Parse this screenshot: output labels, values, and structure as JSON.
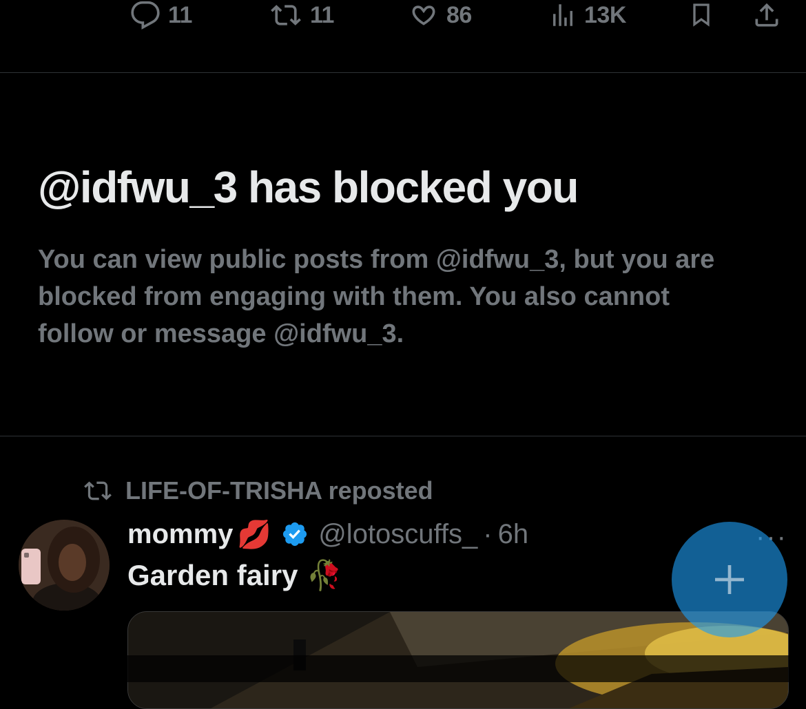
{
  "actions": {
    "reply": {
      "icon": "reply-icon",
      "count": "11"
    },
    "repost": {
      "icon": "repost-icon",
      "count": "11"
    },
    "like": {
      "icon": "heart-icon",
      "count": "86"
    },
    "views": {
      "icon": "views-icon",
      "count": "13K"
    },
    "bookmark": {
      "icon": "bookmark-icon"
    },
    "share": {
      "icon": "share-icon"
    }
  },
  "blocked": {
    "title": "@idfwu_3 has blocked you",
    "message": "You can view public posts from @idfwu_3, but you are blocked from engaging with them. You also cannot follow or message @idfwu_3."
  },
  "post": {
    "repost_text": "LIFE-OF-TRISHA reposted",
    "author_name": "mommy",
    "author_emoji": "💋",
    "verified": true,
    "handle": "@lotoscuffs_",
    "separator": "·",
    "time": "6h",
    "text": "Garden fairy",
    "text_emoji": "🥀",
    "more": "···"
  },
  "compose": {
    "icon": "plus-icon"
  },
  "colors": {
    "background": "#000000",
    "text": "#e7e9ea",
    "muted": "#71767b",
    "accent": "#1d9bf0",
    "divider": "#2f3336"
  }
}
